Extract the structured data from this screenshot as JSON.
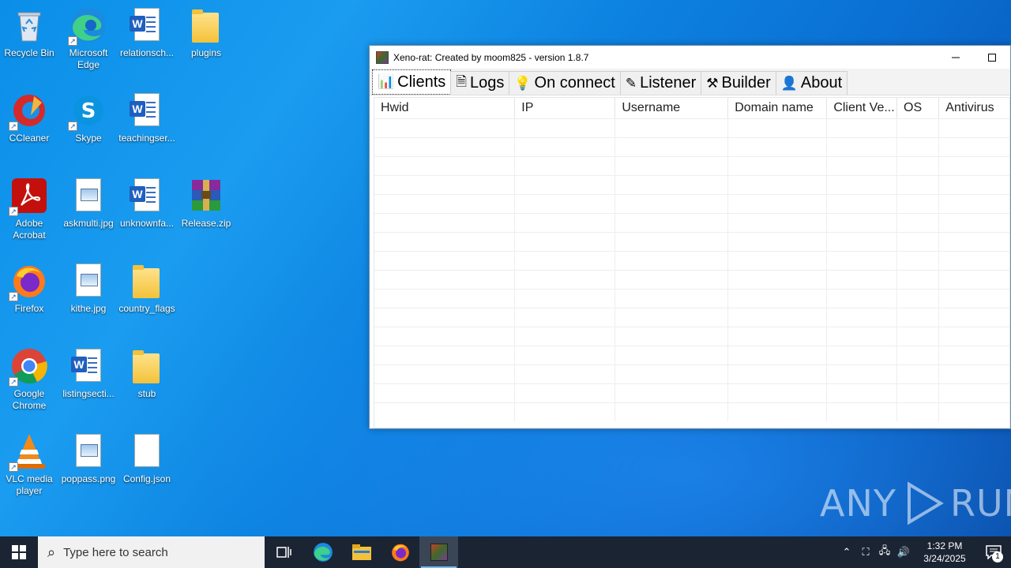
{
  "desktop": {
    "icons": [
      {
        "label": "Recycle Bin",
        "icon": "recycle-bin-icon"
      },
      {
        "label": "Microsoft\nEdge",
        "icon": "edge-icon"
      },
      {
        "label": "relationsch...",
        "icon": "word-document-icon"
      },
      {
        "label": "plugins",
        "icon": "folder-icon"
      },
      {
        "label": "CCleaner",
        "icon": "ccleaner-icon"
      },
      {
        "label": "Skype",
        "icon": "skype-icon"
      },
      {
        "label": "teachingser...",
        "icon": "word-document-icon"
      },
      {
        "label": "Adobe\nAcrobat",
        "icon": "acrobat-icon"
      },
      {
        "label": "askmulti.jpg",
        "icon": "image-file-icon"
      },
      {
        "label": "unknownfa...",
        "icon": "word-document-icon"
      },
      {
        "label": "Release.zip",
        "icon": "winrar-archive-icon"
      },
      {
        "label": "Firefox",
        "icon": "firefox-icon"
      },
      {
        "label": "kithe.jpg",
        "icon": "image-file-icon"
      },
      {
        "label": "country_flags",
        "icon": "folder-icon"
      },
      {
        "label": "Google\nChrome",
        "icon": "chrome-icon"
      },
      {
        "label": "listingsecti...",
        "icon": "word-document-icon"
      },
      {
        "label": "stub",
        "icon": "folder-icon"
      },
      {
        "label": "VLC media\nplayer",
        "icon": "vlc-icon"
      },
      {
        "label": "poppass.png",
        "icon": "image-file-icon"
      },
      {
        "label": "Config.json",
        "icon": "blank-file-icon"
      }
    ]
  },
  "window": {
    "title": "Xeno-rat: Created by moom825 - version 1.8.7",
    "tabs": [
      {
        "label": "Clients",
        "icon": "bar-chart-icon",
        "glyph": "📊"
      },
      {
        "label": "Logs",
        "icon": "document-icon",
        "glyph": "🗎"
      },
      {
        "label": "On connect",
        "icon": "lightbulb-icon",
        "glyph": "💡"
      },
      {
        "label": "Listener",
        "icon": "pencil-icon",
        "glyph": "✎"
      },
      {
        "label": "Builder",
        "icon": "tools-icon",
        "glyph": "⚒"
      },
      {
        "label": "About",
        "icon": "person-icon",
        "glyph": "👤"
      }
    ],
    "columns": [
      "Hwid",
      "IP",
      "Username",
      "Domain name",
      "Client Ve...",
      "OS",
      "Antivirus"
    ]
  },
  "watermark": {
    "left": "ANY",
    "right": "RUN"
  },
  "taskbar": {
    "search_placeholder": "Type here to search",
    "time": "1:32 PM",
    "date": "3/24/2025",
    "notification_count": "1"
  }
}
